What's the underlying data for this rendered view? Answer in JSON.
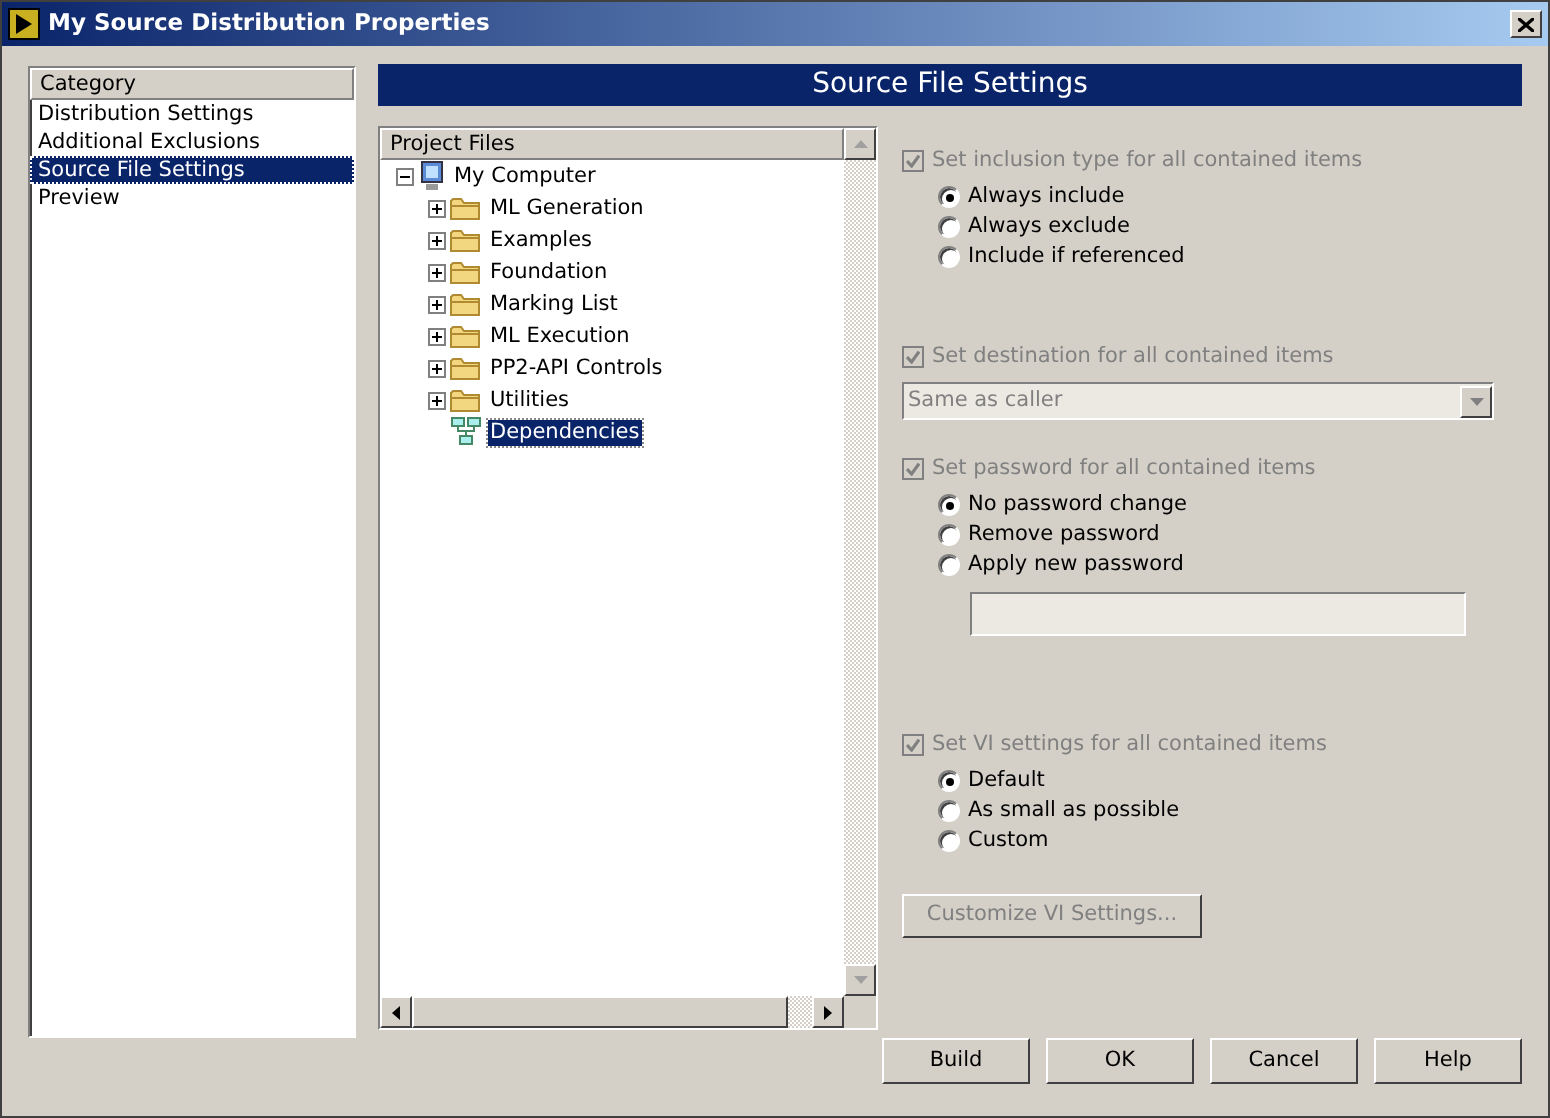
{
  "window": {
    "title": "My Source Distribution Properties"
  },
  "categories": {
    "header": "Category",
    "items": [
      {
        "label": "Distribution Settings",
        "selected": false
      },
      {
        "label": "Additional Exclusions",
        "selected": false
      },
      {
        "label": "Source File Settings",
        "selected": true
      },
      {
        "label": "Preview",
        "selected": false
      }
    ]
  },
  "section_title": "Source File Settings",
  "tree": {
    "header": "Project Files",
    "root": {
      "label": "My Computer",
      "expanded": true,
      "selected": false,
      "children": [
        {
          "label": "ML Generation",
          "kind": "folder",
          "expanded": false,
          "selected": false
        },
        {
          "label": "Examples",
          "kind": "folder",
          "expanded": false,
          "selected": false
        },
        {
          "label": "Foundation",
          "kind": "folder",
          "expanded": false,
          "selected": false
        },
        {
          "label": "Marking List",
          "kind": "folder",
          "expanded": false,
          "selected": false
        },
        {
          "label": "ML Execution",
          "kind": "folder",
          "expanded": false,
          "selected": false
        },
        {
          "label": "PP2-API Controls",
          "kind": "folder",
          "expanded": false,
          "selected": false
        },
        {
          "label": "Utilities",
          "kind": "folder",
          "expanded": false,
          "selected": false
        },
        {
          "label": "Dependencies",
          "kind": "dependencies",
          "selected": true
        }
      ]
    }
  },
  "settings": [
    {
      "kind": "radios",
      "label": "Set inclusion type for all contained items",
      "checked": true,
      "disabled": true,
      "options": [
        {
          "label": "Always include",
          "selected": true
        },
        {
          "label": "Always exclude",
          "selected": false
        },
        {
          "label": "Include if referenced",
          "selected": false
        }
      ]
    },
    {
      "kind": "dropdown",
      "label": "Set destination for all contained items",
      "checked": true,
      "disabled": true,
      "value": "Same as caller"
    },
    {
      "kind": "radios",
      "label": "Set password for all contained items",
      "checked": true,
      "disabled": true,
      "options": [
        {
          "label": "No password change",
          "selected": true
        },
        {
          "label": "Remove password",
          "selected": false
        },
        {
          "label": "Apply new password",
          "selected": false
        }
      ],
      "password_field": {
        "disabled": true
      }
    },
    {
      "kind": "radios",
      "label": "Set VI settings for all contained items",
      "checked": true,
      "disabled": true,
      "options": [
        {
          "label": "Default",
          "selected": true
        },
        {
          "label": "As small as possible",
          "selected": false
        },
        {
          "label": "Custom",
          "selected": false
        }
      ]
    }
  ],
  "customize_button": {
    "label": "Customize VI Settings...",
    "disabled": true
  },
  "buttons": [
    "Build",
    "OK",
    "Cancel",
    "Help"
  ]
}
